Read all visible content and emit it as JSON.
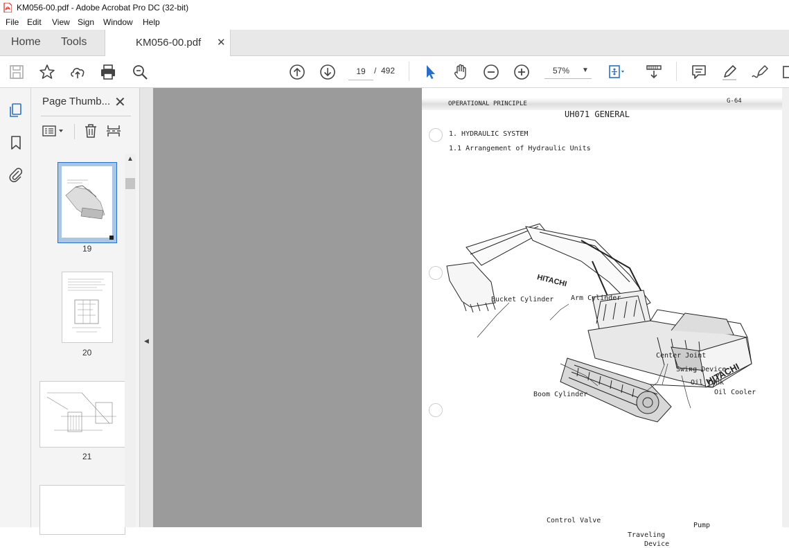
{
  "window": {
    "title": "KM056-00.pdf - Adobe Acrobat Pro DC (32-bit)"
  },
  "menu": [
    "File",
    "Edit",
    "View",
    "Sign",
    "Window",
    "Help"
  ],
  "tabs": {
    "home": "Home",
    "tools": "Tools",
    "document": "KM056-00.pdf"
  },
  "toolbar": {
    "page_current": "19",
    "page_separator": "/",
    "page_total": "492",
    "zoom": "57%"
  },
  "panel": {
    "title": "Page Thumb...",
    "thumbnails": [
      {
        "label": "19",
        "selected": true
      },
      {
        "label": "20",
        "selected": false
      },
      {
        "label": "21",
        "selected": false
      }
    ]
  },
  "document": {
    "header_left": "OPERATIONAL PRINCIPLE",
    "header_right": "G-64",
    "model_title": "UH071 GENERAL",
    "section": "1. HYDRAULIC SYSTEM",
    "subsection": "1.1 Arrangement of Hydraulic Units",
    "brand": "HITACHI",
    "callouts": {
      "bucket_cylinder": "Bucket Cylinder",
      "arm_cylinder": "Arm Cylinder",
      "center_joint": "Center Joint",
      "swing_device": "Swing Device",
      "oil_tank": "Oil Tank",
      "oil_cooler": "Oil Cooler",
      "boom_cylinder": "Boom Cylinder",
      "control_valve": "Control Valve",
      "pump": "Pump",
      "traveling": "Traveling",
      "device": "Device"
    }
  },
  "colors": {
    "accent": "#2a6fc7",
    "pdf_red": "#d7261e",
    "doc_background": "#9b9b9b"
  }
}
